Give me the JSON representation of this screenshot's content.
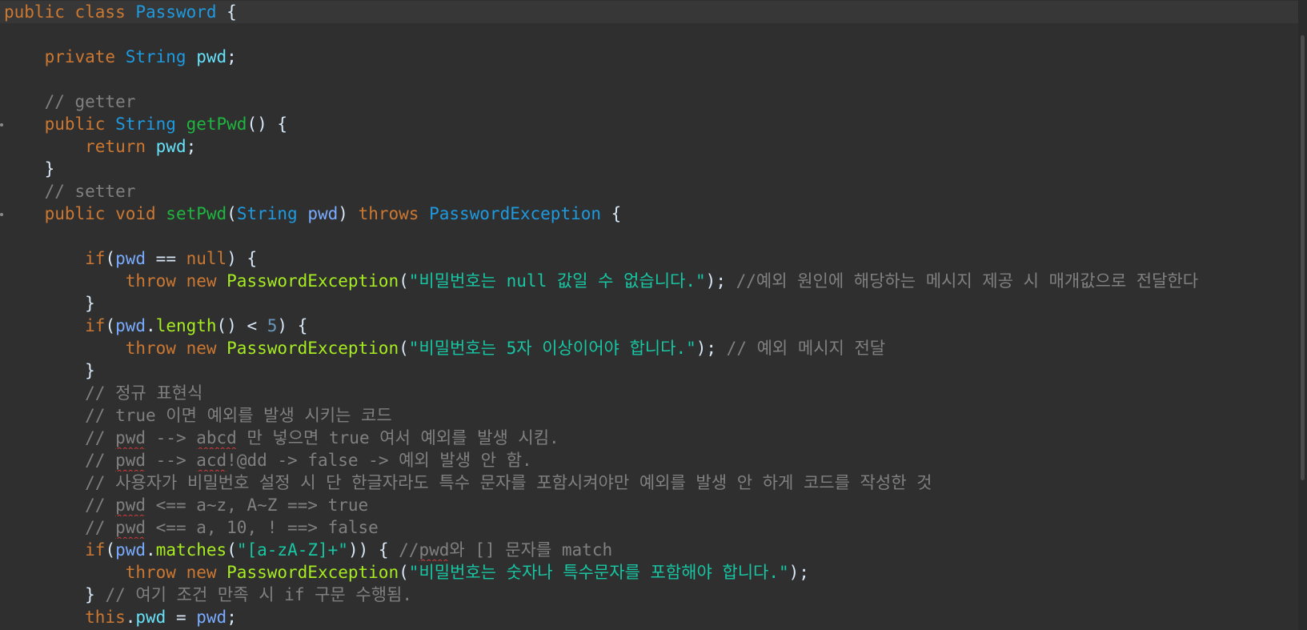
{
  "editor": {
    "current_line": 0,
    "lines": [
      {
        "marker": false,
        "tokens": [
          {
            "t": "public class ",
            "c": "keyword"
          },
          {
            "t": "Password",
            "c": "type"
          },
          {
            "t": " {",
            "c": "plain"
          }
        ]
      },
      {
        "marker": false,
        "tokens": []
      },
      {
        "marker": false,
        "tokens": [
          {
            "t": "    private ",
            "c": "keyword"
          },
          {
            "t": "String",
            "c": "type"
          },
          {
            "t": " ",
            "c": "plain"
          },
          {
            "t": "pwd",
            "c": "field"
          },
          {
            "t": ";",
            "c": "plain"
          }
        ]
      },
      {
        "marker": false,
        "tokens": []
      },
      {
        "marker": false,
        "tokens": [
          {
            "t": "    // getter",
            "c": "comment"
          }
        ]
      },
      {
        "marker": true,
        "tokens": [
          {
            "t": "    public ",
            "c": "keyword"
          },
          {
            "t": "String",
            "c": "type"
          },
          {
            "t": " ",
            "c": "plain"
          },
          {
            "t": "getPwd",
            "c": "method"
          },
          {
            "t": "() {",
            "c": "plain"
          }
        ]
      },
      {
        "marker": false,
        "tokens": [
          {
            "t": "        return ",
            "c": "keyword"
          },
          {
            "t": "pwd",
            "c": "field"
          },
          {
            "t": ";",
            "c": "plain"
          }
        ]
      },
      {
        "marker": false,
        "tokens": [
          {
            "t": "    }",
            "c": "plain"
          }
        ]
      },
      {
        "marker": false,
        "tokens": [
          {
            "t": "    // setter",
            "c": "comment"
          }
        ]
      },
      {
        "marker": true,
        "tokens": [
          {
            "t": "    public void ",
            "c": "keyword"
          },
          {
            "t": "setPwd",
            "c": "method"
          },
          {
            "t": "(",
            "c": "plain"
          },
          {
            "t": "String",
            "c": "type"
          },
          {
            "t": " ",
            "c": "plain"
          },
          {
            "t": "pwd",
            "c": "param"
          },
          {
            "t": ") ",
            "c": "plain"
          },
          {
            "t": "throws ",
            "c": "keyword"
          },
          {
            "t": "PasswordException",
            "c": "type"
          },
          {
            "t": " {",
            "c": "plain"
          }
        ]
      },
      {
        "marker": false,
        "tokens": []
      },
      {
        "marker": false,
        "tokens": [
          {
            "t": "        if",
            "c": "keyword"
          },
          {
            "t": "(",
            "c": "plain"
          },
          {
            "t": "pwd",
            "c": "param"
          },
          {
            "t": " == ",
            "c": "plain"
          },
          {
            "t": "null",
            "c": "keyword"
          },
          {
            "t": ") {",
            "c": "plain"
          }
        ]
      },
      {
        "marker": false,
        "tokens": [
          {
            "t": "            throw new ",
            "c": "keyword"
          },
          {
            "t": "PasswordException",
            "c": "method-call"
          },
          {
            "t": "(",
            "c": "plain"
          },
          {
            "t": "\"비밀번호는 null 값일 수 없습니다.\"",
            "c": "string"
          },
          {
            "t": "); ",
            "c": "plain"
          },
          {
            "t": "//예외 원인에 해당하는 메시지 제공 시 매개값으로 전달한다",
            "c": "comment"
          }
        ]
      },
      {
        "marker": false,
        "tokens": [
          {
            "t": "        }",
            "c": "plain"
          }
        ]
      },
      {
        "marker": false,
        "tokens": [
          {
            "t": "        if",
            "c": "keyword"
          },
          {
            "t": "(",
            "c": "plain"
          },
          {
            "t": "pwd",
            "c": "param"
          },
          {
            "t": ".",
            "c": "plain"
          },
          {
            "t": "length",
            "c": "method-call"
          },
          {
            "t": "() < ",
            "c": "plain"
          },
          {
            "t": "5",
            "c": "number"
          },
          {
            "t": ") {",
            "c": "plain"
          }
        ]
      },
      {
        "marker": false,
        "tokens": [
          {
            "t": "            throw new ",
            "c": "keyword"
          },
          {
            "t": "PasswordException",
            "c": "method-call"
          },
          {
            "t": "(",
            "c": "plain"
          },
          {
            "t": "\"비밀번호는 5자 이상이어야 합니다.\"",
            "c": "string"
          },
          {
            "t": "); ",
            "c": "plain"
          },
          {
            "t": "// 예외 메시지 전달",
            "c": "comment"
          }
        ]
      },
      {
        "marker": false,
        "tokens": [
          {
            "t": "        }",
            "c": "plain"
          }
        ]
      },
      {
        "marker": false,
        "tokens": [
          {
            "t": "        // 정규 표현식",
            "c": "comment"
          }
        ]
      },
      {
        "marker": false,
        "tokens": [
          {
            "t": "        // true 이면 예외를 발생 시키는 코드",
            "c": "comment"
          }
        ]
      },
      {
        "marker": false,
        "tokens": [
          {
            "t": "        // ",
            "c": "comment"
          },
          {
            "t": "pwd",
            "c": "comment",
            "spell": true
          },
          {
            "t": " --> ",
            "c": "comment"
          },
          {
            "t": "abcd",
            "c": "comment",
            "spell": true
          },
          {
            "t": " 만 넣으면 true 여서 예외를 발생 시킴.",
            "c": "comment"
          }
        ]
      },
      {
        "marker": false,
        "tokens": [
          {
            "t": "        // ",
            "c": "comment"
          },
          {
            "t": "pwd",
            "c": "comment",
            "spell": true
          },
          {
            "t": " --> ",
            "c": "comment"
          },
          {
            "t": "acd",
            "c": "comment",
            "spell": true
          },
          {
            "t": "!@dd -> false -> 예외 발생 안 함.",
            "c": "comment"
          }
        ]
      },
      {
        "marker": false,
        "tokens": [
          {
            "t": "        // 사용자가 비밀번호 설정 시 단 한글자라도 특수 문자를 포함시켜야만 예외를 발생 안 하게 코드를 작성한 것",
            "c": "comment"
          }
        ]
      },
      {
        "marker": false,
        "tokens": [
          {
            "t": "        // ",
            "c": "comment"
          },
          {
            "t": "pwd",
            "c": "comment",
            "spell": true
          },
          {
            "t": " <== a~z, A~Z ==> true",
            "c": "comment"
          }
        ]
      },
      {
        "marker": false,
        "tokens": [
          {
            "t": "        // ",
            "c": "comment"
          },
          {
            "t": "pwd",
            "c": "comment",
            "spell": true
          },
          {
            "t": " <== a, 10, ! ==> false",
            "c": "comment"
          }
        ]
      },
      {
        "marker": false,
        "tokens": [
          {
            "t": "        if",
            "c": "keyword"
          },
          {
            "t": "(",
            "c": "plain"
          },
          {
            "t": "pwd",
            "c": "param"
          },
          {
            "t": ".",
            "c": "plain"
          },
          {
            "t": "matches",
            "c": "method-call"
          },
          {
            "t": "(",
            "c": "plain"
          },
          {
            "t": "\"[a-zA-Z]+\"",
            "c": "string"
          },
          {
            "t": ")) { ",
            "c": "plain"
          },
          {
            "t": "//",
            "c": "comment"
          },
          {
            "t": "pwd",
            "c": "comment",
            "spell": true
          },
          {
            "t": "와 [] 문자를 match",
            "c": "comment"
          }
        ]
      },
      {
        "marker": false,
        "tokens": [
          {
            "t": "            throw new ",
            "c": "keyword"
          },
          {
            "t": "PasswordException",
            "c": "method-call"
          },
          {
            "t": "(",
            "c": "plain"
          },
          {
            "t": "\"비밀번호는 숫자나 특수문자를 포함해야 합니다.\"",
            "c": "string"
          },
          {
            "t": ");",
            "c": "plain"
          }
        ]
      },
      {
        "marker": false,
        "tokens": [
          {
            "t": "        } ",
            "c": "plain"
          },
          {
            "t": "// 여기 조건 만족 시 if 구문 수행됨.",
            "c": "comment"
          }
        ]
      },
      {
        "marker": false,
        "tokens": [
          {
            "t": "        this",
            "c": "keyword"
          },
          {
            "t": ".",
            "c": "plain"
          },
          {
            "t": "pwd",
            "c": "field"
          },
          {
            "t": " = ",
            "c": "plain"
          },
          {
            "t": "pwd",
            "c": "param"
          },
          {
            "t": ";",
            "c": "plain"
          }
        ]
      }
    ]
  }
}
